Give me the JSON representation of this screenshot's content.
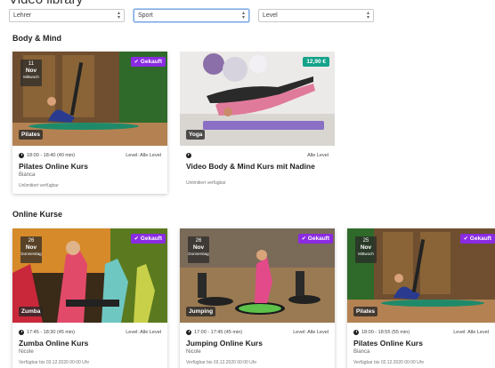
{
  "page": {
    "title": "Video library"
  },
  "filters": [
    {
      "value": "Lehrer"
    },
    {
      "value": "Sport"
    },
    {
      "value": "Level"
    }
  ],
  "sections": [
    {
      "title": "Body & Mind",
      "cards": [
        {
          "date_day": "11",
          "date_month": "Nov",
          "date_weekday": "Mittwoch",
          "badge": "Gekauft",
          "category": "Pilates",
          "time": "18:00 - 18:40 (40 min)",
          "level": "Level: Alle Level",
          "title": "Pilates Online Kurs",
          "trainer": "Bianca",
          "availability": "Unlimitiert verfügbar"
        },
        {
          "price": "12,90 €",
          "category": "Yoga",
          "level": "Alle Level",
          "title": "Video Body & Mind Kurs mit Nadine",
          "availability": "Unlimitiert verfügbar"
        }
      ]
    },
    {
      "title": "Online Kurse",
      "cards": [
        {
          "date_day": "26",
          "date_month": "Nov",
          "date_weekday": "Donnerstag",
          "badge": "Gekauft",
          "category": "Zumba",
          "time": "17:45 - 18:30 (45 min)",
          "level": "Level: Alle Level",
          "title": "Zumba Online Kurs",
          "trainer": "Nicole",
          "availability": "Verfügbar bis 03.12.2020 00:00 Uhr"
        },
        {
          "date_day": "26",
          "date_month": "Nov",
          "date_weekday": "Donnerstag",
          "badge": "Gekauft",
          "category": "Jumping",
          "time": "17:00 - 17:45 (45 min)",
          "level": "Level: Alle Level",
          "title": "Jumping Online Kurs",
          "trainer": "Nicole",
          "availability": "Verfügbar bis 03.12.2020 00:00 Uhr"
        },
        {
          "date_day": "25",
          "date_month": "Nov",
          "date_weekday": "Mittwoch",
          "badge": "Gekauft",
          "category": "Pilates",
          "time": "18:00 - 18:55 (55 min)",
          "level": "Level: Alle Level",
          "title": "Pilates Online Kurs",
          "trainer": "Bianca",
          "availability": "Verfügbar bis 02.12.2020 00:00 Uhr"
        }
      ]
    }
  ],
  "icons": {
    "clock": "clock-icon",
    "play": "play-icon",
    "check": "check-icon",
    "select_arrow": "chevron-updown-icon"
  },
  "colors": {
    "purchased": "#8a2be2",
    "price": "#15a38a"
  }
}
